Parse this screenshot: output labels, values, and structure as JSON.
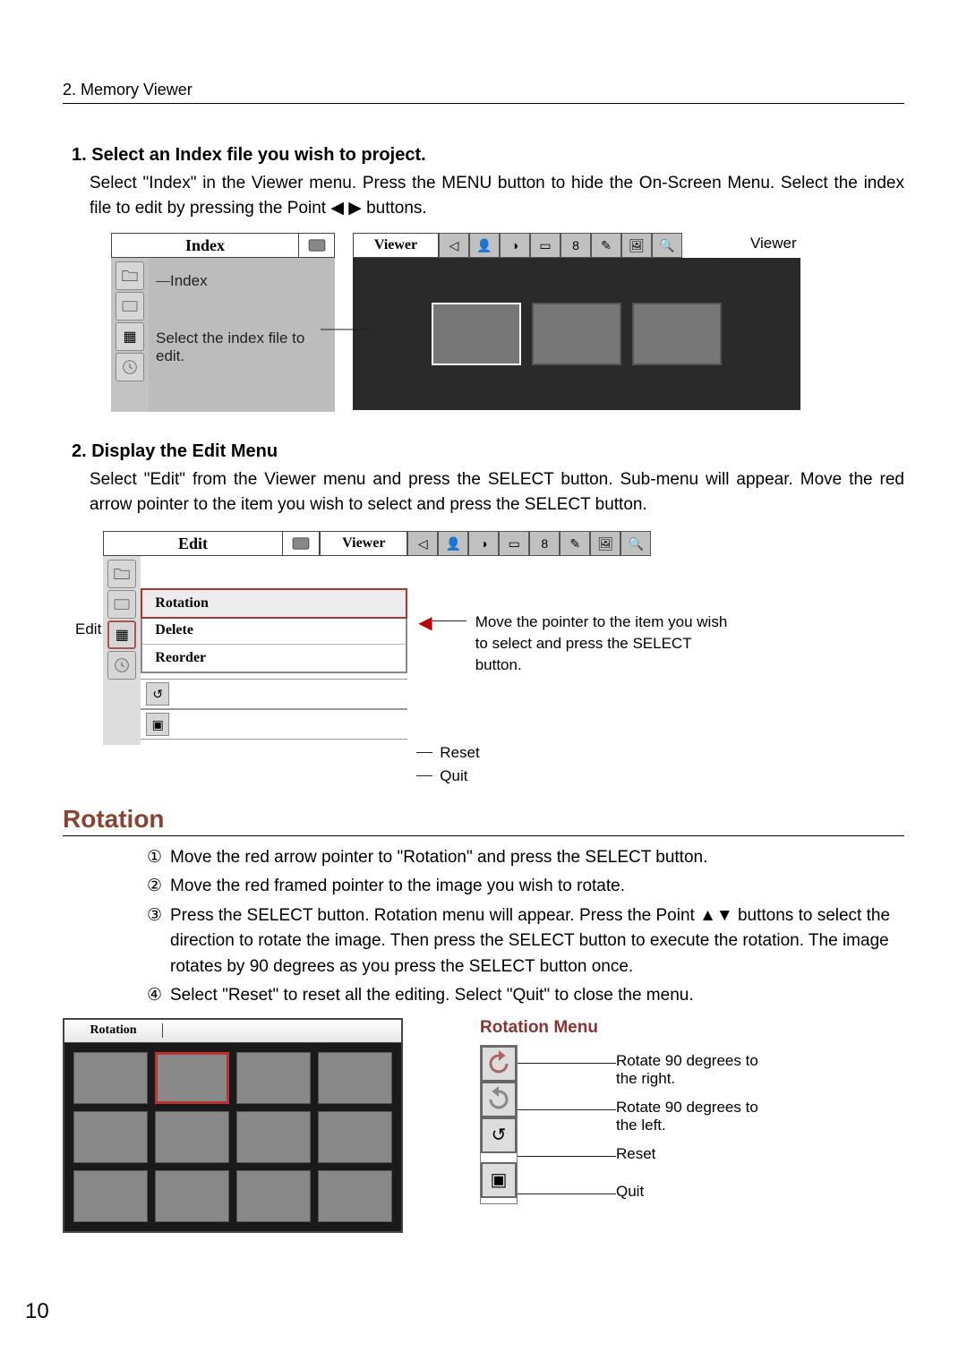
{
  "header_section": "2. Memory Viewer",
  "step1": {
    "title": "1. Select an Index file you wish to project.",
    "desc": "Select \"Index\" in the Viewer menu.  Press the MENU button to hide the On-Screen Menu.  Select the index file to edit by pressing the Point ◀ ▶ buttons."
  },
  "fig1": {
    "menu_title": "Index",
    "index_label": "Index",
    "select_label": "Select the index file to edit.",
    "viewer_label": "Viewer",
    "viewer_caption": "Viewer"
  },
  "step2": {
    "title": "2. Display the Edit Menu",
    "desc": "Select \"Edit\" from the Viewer menu and press the SELECT button.  Sub-menu will appear.  Move the red arrow pointer to the item you wish to select and press the SELECT button."
  },
  "fig2": {
    "menu_title": "Edit",
    "viewer_label": "Viewer",
    "edit_label": "Edit",
    "submenu": [
      "Rotation",
      "Delete",
      "Reorder"
    ],
    "caption_main": "Move the pointer to the item you wish to select and press the SELECT button.",
    "reset_label": "Reset",
    "quit_label": "Quit"
  },
  "rotation": {
    "heading": "Rotation",
    "steps": [
      "Move the red arrow pointer to \"Rotation\" and press the SELECT button.",
      "Move the red framed pointer to the image you wish to rotate.",
      "Press the SELECT button.  Rotation menu will appear.  Press the Point ▲▼ buttons to select the direction to rotate the image.  Then press the SELECT button to execute the rotation.  The image rotates by 90 degrees as you press the SELECT button once.",
      "Select \"Reset\" to reset all the editing.  Select \"Quit\" to close the menu."
    ],
    "fig_title": "Rotation",
    "menu_title": "Rotation Menu",
    "menu_items": {
      "right": "Rotate 90 degrees to the right.",
      "left": "Rotate 90 degrees to the left.",
      "reset": "Reset",
      "quit": "Quit"
    }
  },
  "page_number": "10"
}
